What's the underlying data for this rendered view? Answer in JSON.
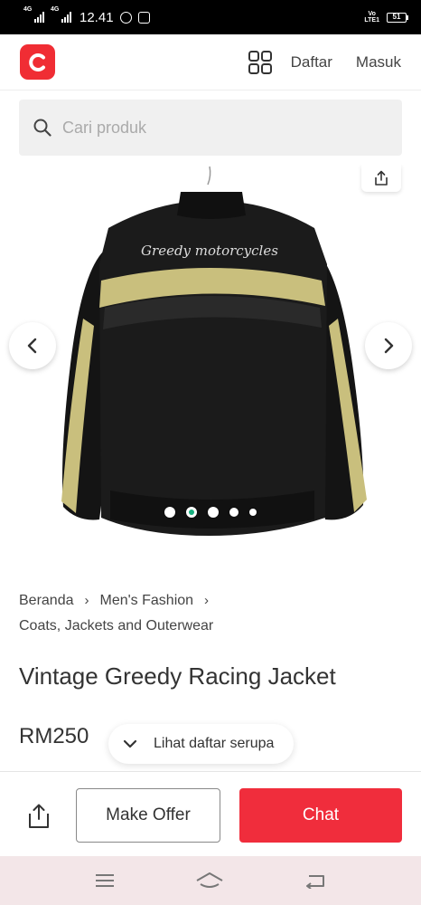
{
  "status_bar": {
    "signal_1_label": "4G",
    "signal_2_label": "4G",
    "time": "12.41",
    "volte_label_1": "Vo",
    "volte_label_2": "LTE1",
    "battery": "51"
  },
  "header": {
    "logo_icon": "carousell-logo-icon",
    "grid_icon": "grid-icon",
    "register_label": "Daftar",
    "login_label": "Masuk"
  },
  "search": {
    "placeholder": "Cari produk"
  },
  "gallery": {
    "image_description_icon": "product-photo",
    "dot_count": 5,
    "active_index": 1
  },
  "breadcrumb": {
    "items": [
      "Beranda",
      "Men's Fashion",
      "Coats, Jackets and Outerwear"
    ]
  },
  "product": {
    "title": "Vintage Greedy Racing Jacket",
    "price": "RM250",
    "jacket_text": "Greedy motorcycles"
  },
  "similar": {
    "label": "Lihat daftar serupa"
  },
  "actions": {
    "make_offer_label": "Make Offer",
    "chat_label": "Chat"
  },
  "colors": {
    "brand_red": "#f02d34",
    "chat_red": "#f02d3c",
    "active_dot": "#17b07f"
  }
}
